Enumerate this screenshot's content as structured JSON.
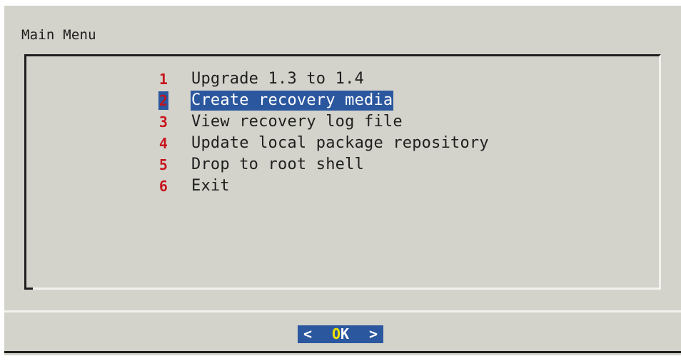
{
  "dialog": {
    "title": "Main Menu"
  },
  "menu": {
    "items": [
      {
        "tag": "1",
        "label": "Upgrade 1.3 to 1.4",
        "selected": false
      },
      {
        "tag": "2",
        "label": "Create recovery media",
        "selected": true
      },
      {
        "tag": "3",
        "label": "View recovery log file",
        "selected": false
      },
      {
        "tag": "4",
        "label": "Update local package repository",
        "selected": false
      },
      {
        "tag": "5",
        "label": "Drop to root shell",
        "selected": false
      },
      {
        "tag": "6",
        "label": "Exit",
        "selected": false
      }
    ]
  },
  "button": {
    "left_bracket": "<",
    "hotkey": "O",
    "rest": "K",
    "right_bracket": ">"
  },
  "colors": {
    "dialog_background": "#d3d3cb",
    "selection_background": "#2b579f",
    "tag_color": "#c8141e",
    "hotkey_color": "#f0e000"
  }
}
